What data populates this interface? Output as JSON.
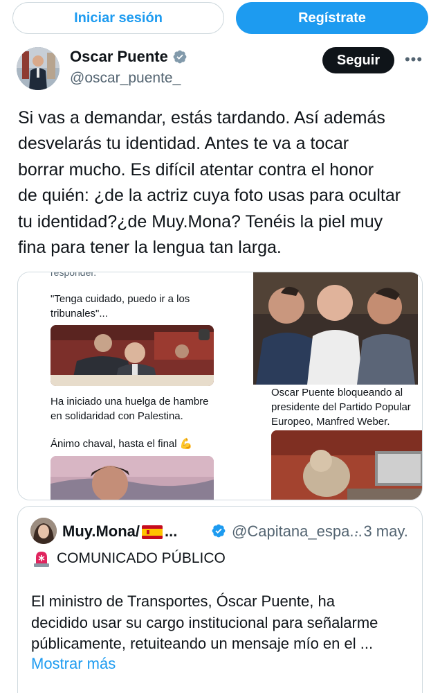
{
  "auth": {
    "login_label": "Iniciar sesión",
    "register_label": "Regístrate"
  },
  "tweet": {
    "author_name": "Oscar Puente",
    "handle": "@oscar_puente_",
    "follow_label": "Seguir",
    "more_label": "•••",
    "text_lines": [
      "Si vas a demandar, estás tardando. Así además",
      "desvelarás tu identidad. Antes te va a tocar",
      "borrar mucho. Es difícil atentar contra el honor",
      "de quién: ¿de la actriz cuya foto usas para ocultar",
      "tu identidad?¿de Muy.Mona? Tenéis la piel muy",
      "fina para tener la lengua tan larga."
    ]
  },
  "media": {
    "left": {
      "top_cut": "responder.",
      "quote_lines": [
        "\"Tenga cuidado, puedo ir a los",
        "tribunales\"..."
      ],
      "caption_lines": [
        "Ha iniciado una huelga de hambre",
        "en solidaridad con Palestina."
      ],
      "cheer": "Ánimo chaval, hasta el final 💪"
    },
    "right": {
      "caption_lines": [
        "Oscar Puente bloqueando al",
        "presidente del Partido Popular",
        "Europeo, Manfred Weber."
      ]
    }
  },
  "quote": {
    "author_name": "Muy.Mona/",
    "name_ellipsis": "...",
    "handle": "@Capitana_espa...",
    "date": "· 3 may.",
    "headline": "COMUNICADO PÚBLICO",
    "body_lines": [
      "El ministro de Transportes, Óscar Puente, ha",
      "decidido usar su cargo institucional para señalarme",
      "públicamente, retuiteando un mensaje mío en el ..."
    ],
    "show_more": "Mostrar más"
  },
  "icons": {
    "verified": "verified-badge-icon",
    "siren": "siren-icon",
    "flag": "spain-flag-icon"
  },
  "colors": {
    "accent": "#1d9bf0",
    "text": "#0f1419",
    "secondary": "#536471",
    "border": "#cfd9de"
  }
}
